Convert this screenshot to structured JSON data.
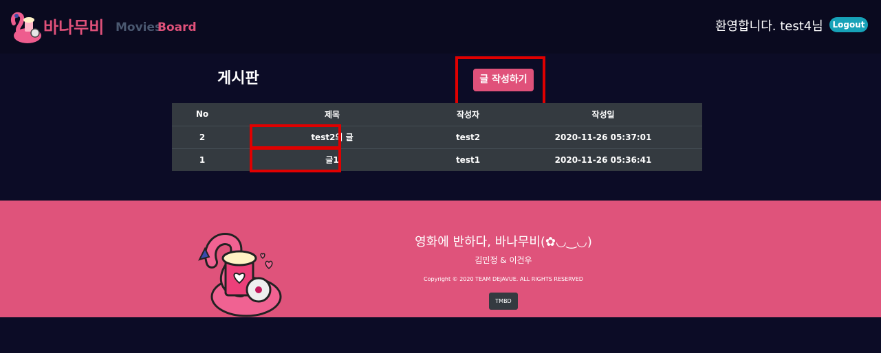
{
  "navbar": {
    "brand": "바나무비",
    "links": [
      "Movies",
      "Board"
    ],
    "welcome": "환영합니다. test4님",
    "logout": "Logout"
  },
  "board": {
    "title": "게시판",
    "write_button": "글 작성하기",
    "columns": [
      "No",
      "제목",
      "작성자",
      "작성일"
    ],
    "rows": [
      {
        "no": "2",
        "title": "test2의 글",
        "writer": "test2",
        "date": "2020-11-26 05:37:01"
      },
      {
        "no": "1",
        "title": "글1",
        "writer": "test1",
        "date": "2020-11-26 05:36:41"
      }
    ]
  },
  "footer": {
    "title": "영화에 반하다, 바나무비(✿◡‿◡)",
    "authors": "김민정 & 이건우",
    "copyright": "Copyright © 2020 TEAM DEJAVUE. ALL RIGHTS RESERVED",
    "tmbd": "TMBD"
  },
  "colors": {
    "accent": "#e0517a",
    "highlight": "#e00000",
    "background": "#0c0c26",
    "logout": "#17a2b8"
  }
}
